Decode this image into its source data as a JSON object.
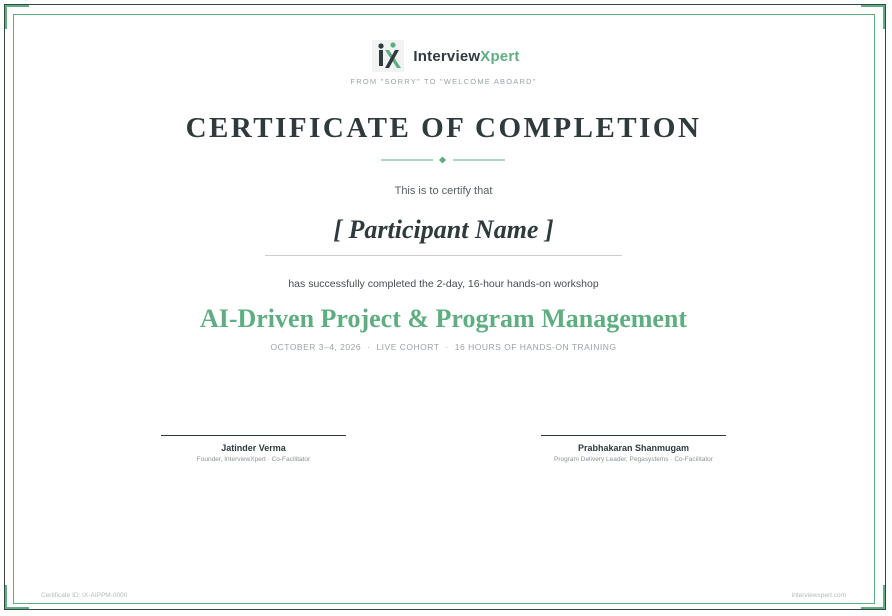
{
  "brand": {
    "name_part1": "Interview",
    "name_part2": "Xpert",
    "tagline": "FROM \"SORRY\" TO \"WELCOME ABOARD\"",
    "logo_icon": "ix-logo-icon"
  },
  "certificate": {
    "title": "CERTIFICATE OF COMPLETION",
    "certify_text": "This is to certify that",
    "participant_name": "[ Participant Name ]",
    "completion_text": "has successfully completed the 2-day, 16-hour hands-on workshop",
    "course_title": "AI-Driven Project & Program Management",
    "meta": {
      "dates": "OCTOBER 3–4, 2026",
      "cohort": "LIVE COHORT",
      "hours": "16 HOURS OF HANDS-ON TRAINING",
      "separator": "·"
    }
  },
  "signatories": [
    {
      "name": "Jatinder Verma",
      "role": "Founder, InterviewXpert · Co-Facilitator"
    },
    {
      "name": "Prabhakaran Shanmugam",
      "role": "Program Delivery Leader, Pegasystems · Co-Facilitator"
    }
  ],
  "footer": {
    "certificate_id": "Certificate ID: IX-AIPPM-0000",
    "website": "interviewxpert.com"
  },
  "colors": {
    "accent": "#5fae82",
    "dark": "#2f3a3d",
    "muted": "#9aa3a6"
  }
}
